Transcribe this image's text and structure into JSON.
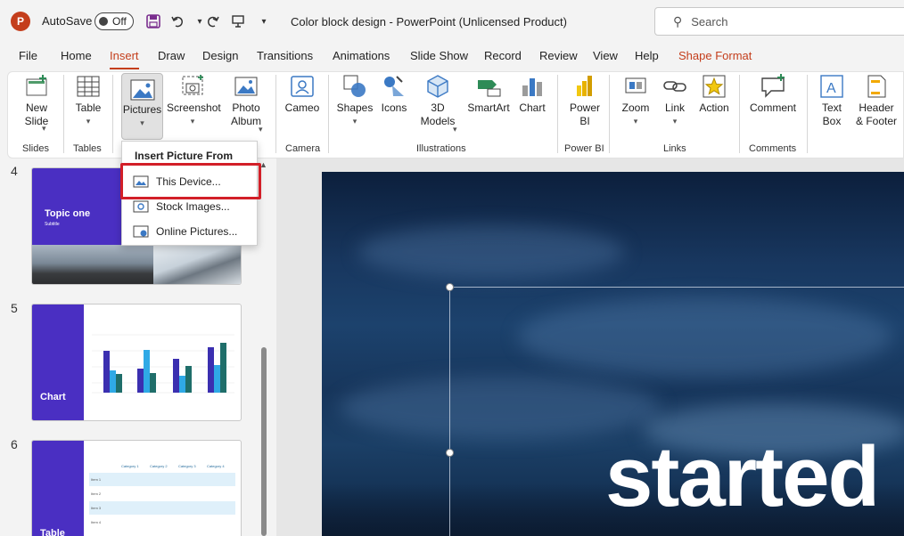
{
  "titlebar": {
    "app_logo": "P",
    "autosave_label": "AutoSave",
    "autosave_state": "Off",
    "doc_title": "Color block design  -  PowerPoint (Unlicensed Product)",
    "search_placeholder": "Search",
    "quick_access_icons": [
      "save-icon",
      "undo-icon",
      "redo-icon",
      "present-icon",
      "customize-icon"
    ]
  },
  "menu": {
    "tabs": [
      "File",
      "Home",
      "Insert",
      "Draw",
      "Design",
      "Transitions",
      "Animations",
      "Slide Show",
      "Record",
      "Review",
      "View",
      "Help",
      "Shape Format"
    ],
    "active": "Insert"
  },
  "ribbon": {
    "new_slide": "New\nSlide",
    "table": "Table",
    "pictures": "Pictures",
    "screenshot": "Screenshot",
    "photo_album": "Photo\nAlbum",
    "cameo": "Cameo",
    "shapes": "Shapes",
    "icons": "Icons",
    "models_3d": "3D\nModels",
    "smartart": "SmartArt",
    "chart": "Chart",
    "power_bi": "Power\nBI",
    "zoom": "Zoom",
    "link": "Link",
    "action": "Action",
    "comment": "Comment",
    "text_box": "Text\nBox",
    "header_footer": "Header\n& Footer",
    "groups": {
      "slides": "Slides",
      "tables": "Tables",
      "camera": "Camera",
      "illustrations": "Illustrations",
      "power_bi": "Power BI",
      "links": "Links",
      "comments": "Comments"
    }
  },
  "dropdown": {
    "header": "Insert Picture From",
    "items": [
      "This Device...",
      "Stock Images...",
      "Online Pictures..."
    ]
  },
  "thumbnails": [
    {
      "number": "4",
      "title": "Topic one",
      "subtitle": "Subtitle"
    },
    {
      "number": "5",
      "title": "Chart"
    },
    {
      "number": "6",
      "title": "Table",
      "columns": [
        "Category 1",
        "Category 2",
        "Category 3",
        "Category 4"
      ],
      "rows": [
        "Item 1",
        "Item 2",
        "Item 3",
        "Item 4"
      ]
    }
  ],
  "slide": {
    "visible_text": "started"
  },
  "colors": {
    "accent": "#c43e1c",
    "highlight_box": "#d21f28",
    "thumbnail_purple": "#4a2fc2"
  }
}
